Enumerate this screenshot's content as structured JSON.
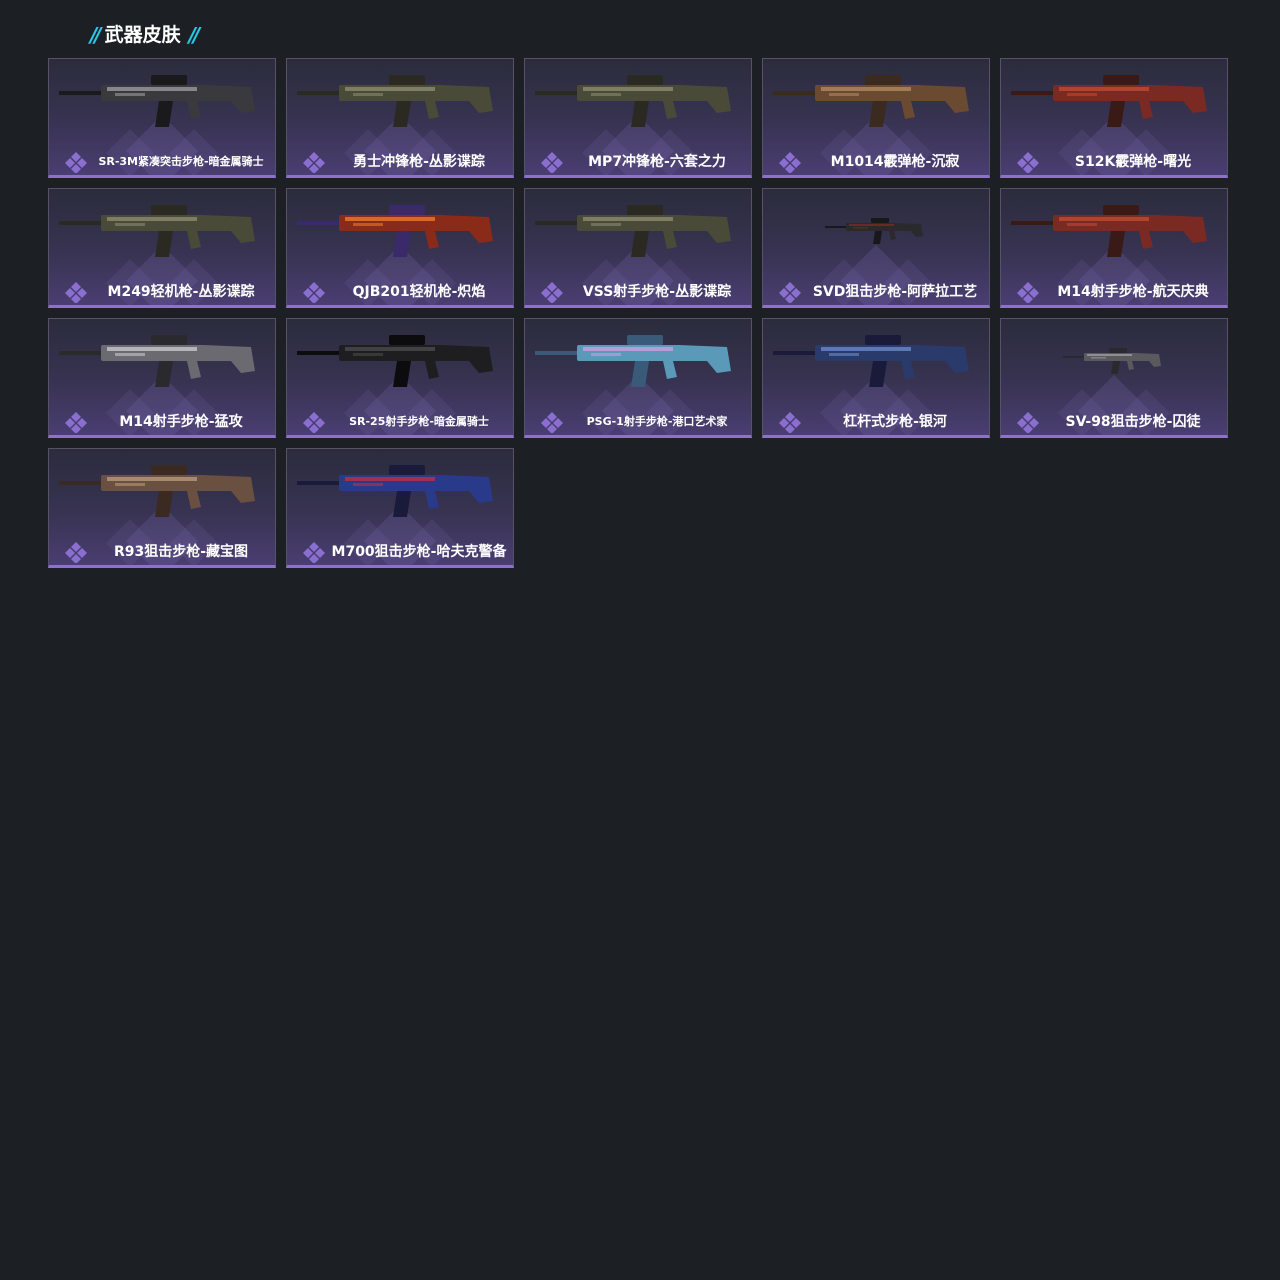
{
  "section": {
    "title": "武器皮肤",
    "slash_left": "//",
    "slash_right": "//"
  },
  "colors": {
    "page_bg": "#1c2025",
    "accent_cyan": "#28c8e8",
    "card_border_bottom": "#8d70d0",
    "rarity_purple": "#8b6fd0"
  },
  "icons": {
    "rarity": "diamond-cluster-icon"
  },
  "skins": [
    {
      "name": "SR-3M紧凑突击步枪-暗金属骑士",
      "palette": "dark-silver"
    },
    {
      "name": "勇士冲锋枪-丛影谍踪",
      "palette": "camo"
    },
    {
      "name": "MP7冲锋枪-六套之力",
      "palette": "camo"
    },
    {
      "name": "M1014霰弹枪-沉寂",
      "palette": "bronze"
    },
    {
      "name": "S12K霰弹枪-曙光",
      "palette": "red"
    },
    {
      "name": "M249轻机枪-丛影谍踪",
      "palette": "camo"
    },
    {
      "name": "QJB201轻机枪-炽焰",
      "palette": "flame"
    },
    {
      "name": "VSS射手步枪-丛影谍踪",
      "palette": "camo"
    },
    {
      "name": "SVD狙击步枪-阿萨拉工艺",
      "palette": "dark-red"
    },
    {
      "name": "M14射手步枪-航天庆典",
      "palette": "red"
    },
    {
      "name": "M14射手步枪-猛攻",
      "palette": "silver"
    },
    {
      "name": "SR-25射手步枪-暗金属骑士",
      "palette": "black"
    },
    {
      "name": "PSG-1射手步枪-港口艺术家",
      "palette": "pastel"
    },
    {
      "name": "杠杆式步枪-银河",
      "palette": "galaxy"
    },
    {
      "name": "SV-98狙击步枪-囚徒",
      "palette": "grey"
    },
    {
      "name": "R93狙击步枪-藏宝图",
      "palette": "map"
    },
    {
      "name": "M700狙击步枪-哈夫克警备",
      "palette": "blue-red"
    }
  ]
}
